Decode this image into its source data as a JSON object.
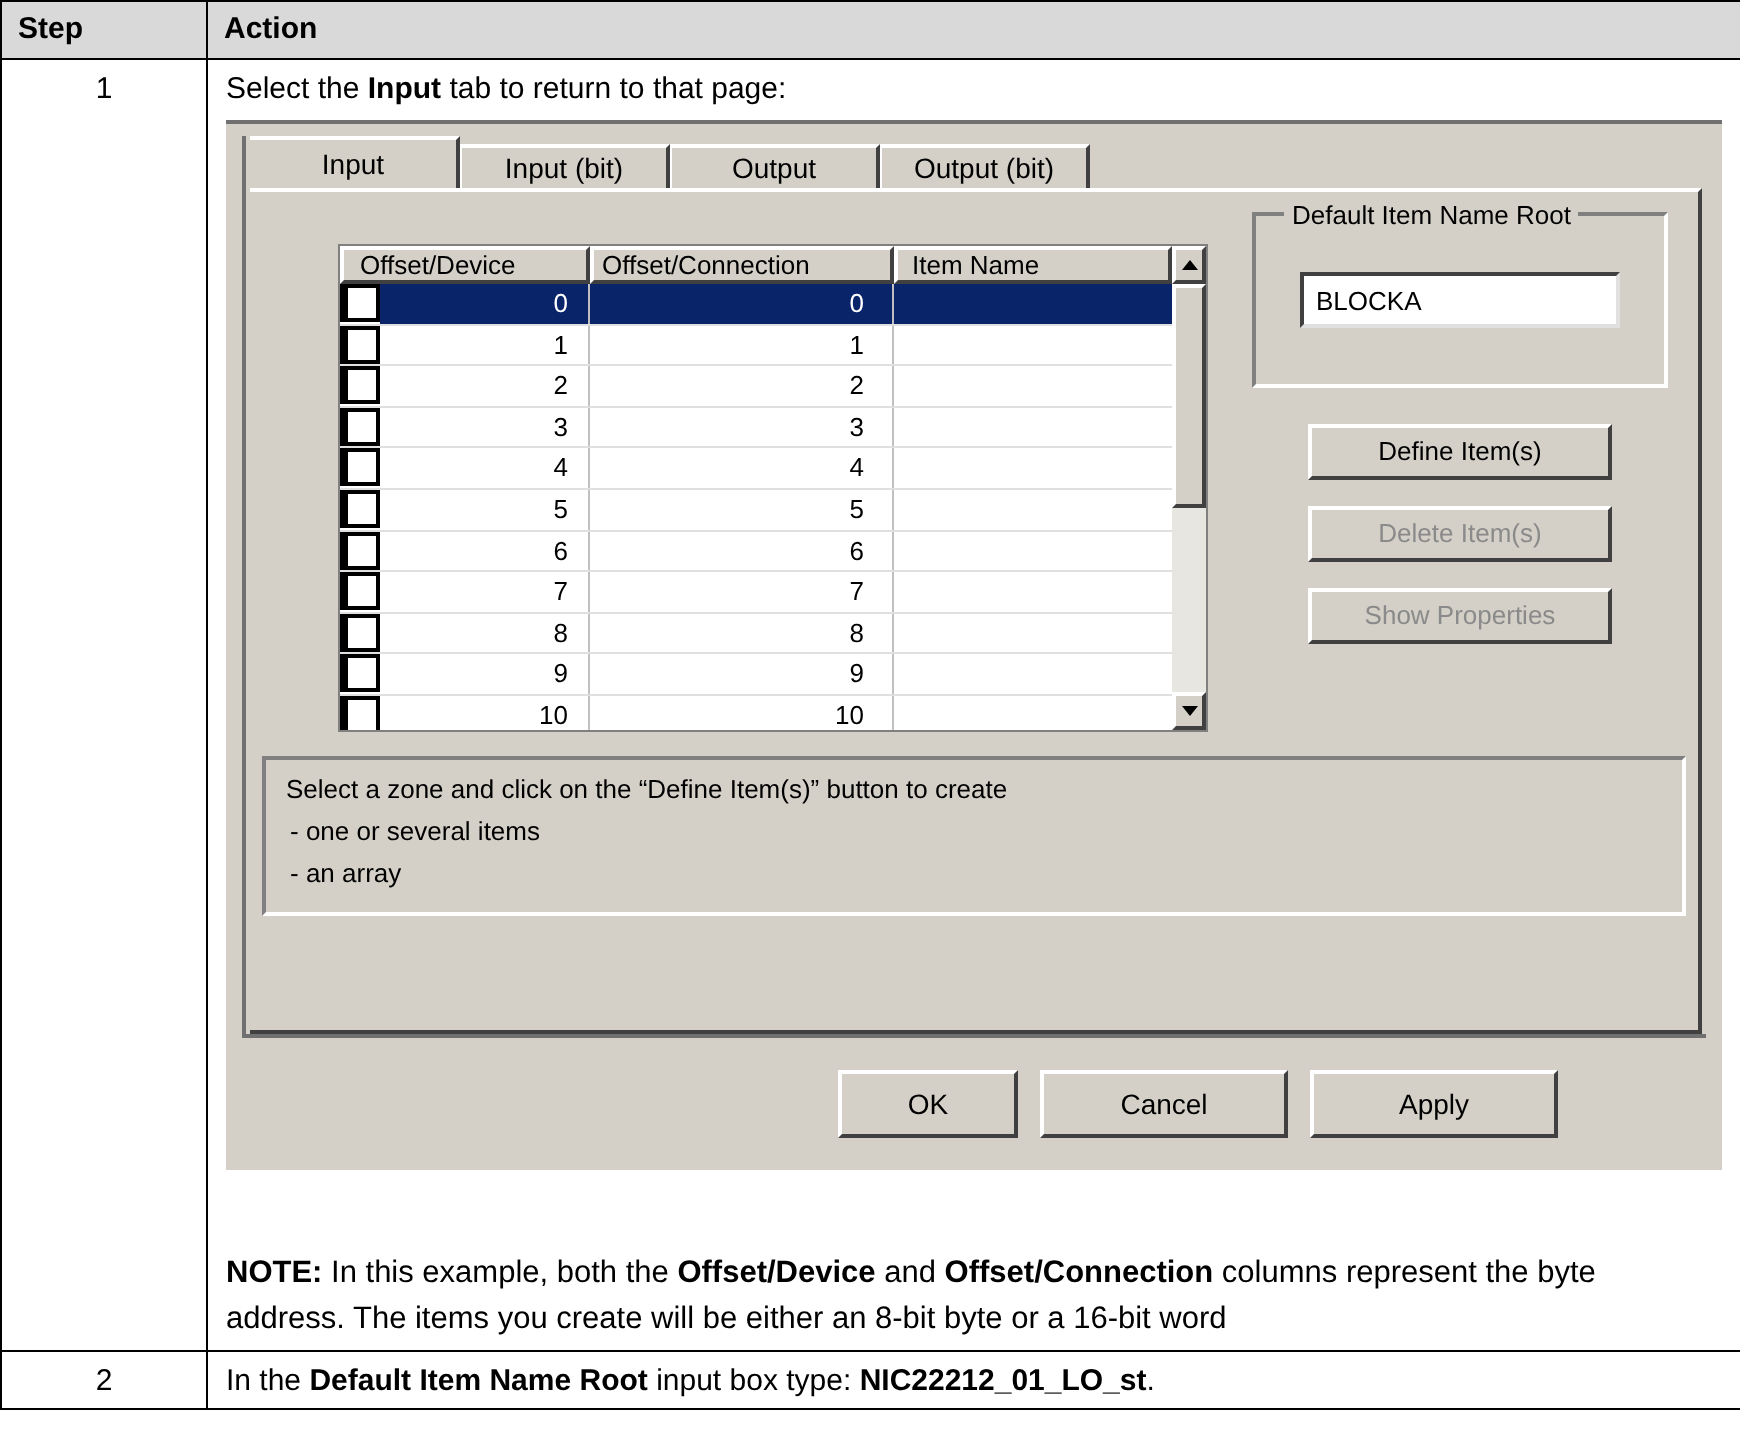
{
  "table": {
    "columns": [
      "Step",
      "Action"
    ],
    "rows": [
      {
        "step": "1",
        "intro": "Select the **Input** tab to return to that page:",
        "dialog": {
          "tabs": [
            {
              "label": "Input",
              "selected": true
            },
            {
              "label": "Input (bit)",
              "selected": false
            },
            {
              "label": "Output",
              "selected": false
            },
            {
              "label": "Output (bit)",
              "selected": false
            }
          ],
          "grid": {
            "columns": [
              "Offset/Device",
              "Offset/Connection",
              "Item Name"
            ],
            "rows": [
              {
                "device": "0",
                "connection": "0",
                "selected": true
              },
              {
                "device": "1",
                "connection": "1",
                "selected": false
              },
              {
                "device": "2",
                "connection": "2",
                "selected": false
              },
              {
                "device": "3",
                "connection": "3",
                "selected": false
              },
              {
                "device": "4",
                "connection": "4",
                "selected": false
              },
              {
                "device": "5",
                "connection": "5",
                "selected": false
              },
              {
                "device": "6",
                "connection": "6",
                "selected": false
              },
              {
                "device": "7",
                "connection": "7",
                "selected": false
              },
              {
                "device": "8",
                "connection": "8",
                "selected": false
              },
              {
                "device": "9",
                "connection": "9",
                "selected": false
              },
              {
                "device": "10",
                "connection": "10",
                "selected": false
              }
            ]
          },
          "name_root": {
            "label": "Default Item Name Root",
            "value": "BLOCKA"
          },
          "side_buttons": [
            {
              "label": "Define Item(s)",
              "disabled": false
            },
            {
              "label": "Delete Item(s)",
              "disabled": true
            },
            {
              "label": "Show Properties",
              "disabled": true
            }
          ],
          "info": [
            "Select a zone and click on the “Define Item(s)” button to create",
            "- one or several items",
            "- an array"
          ],
          "footer_buttons": [
            "OK",
            "Cancel",
            "Apply"
          ]
        },
        "note": "**NOTE:** In this example, both the **Offset/Device** and **Offset/Connection** columns represent the byte address. The items you create will be either an 8-bit byte or a 16-bit word"
      },
      {
        "step": "2",
        "intro": "In the **Default Item Name Root** input box type: **NIC22212_01_LO_st**."
      }
    ]
  }
}
